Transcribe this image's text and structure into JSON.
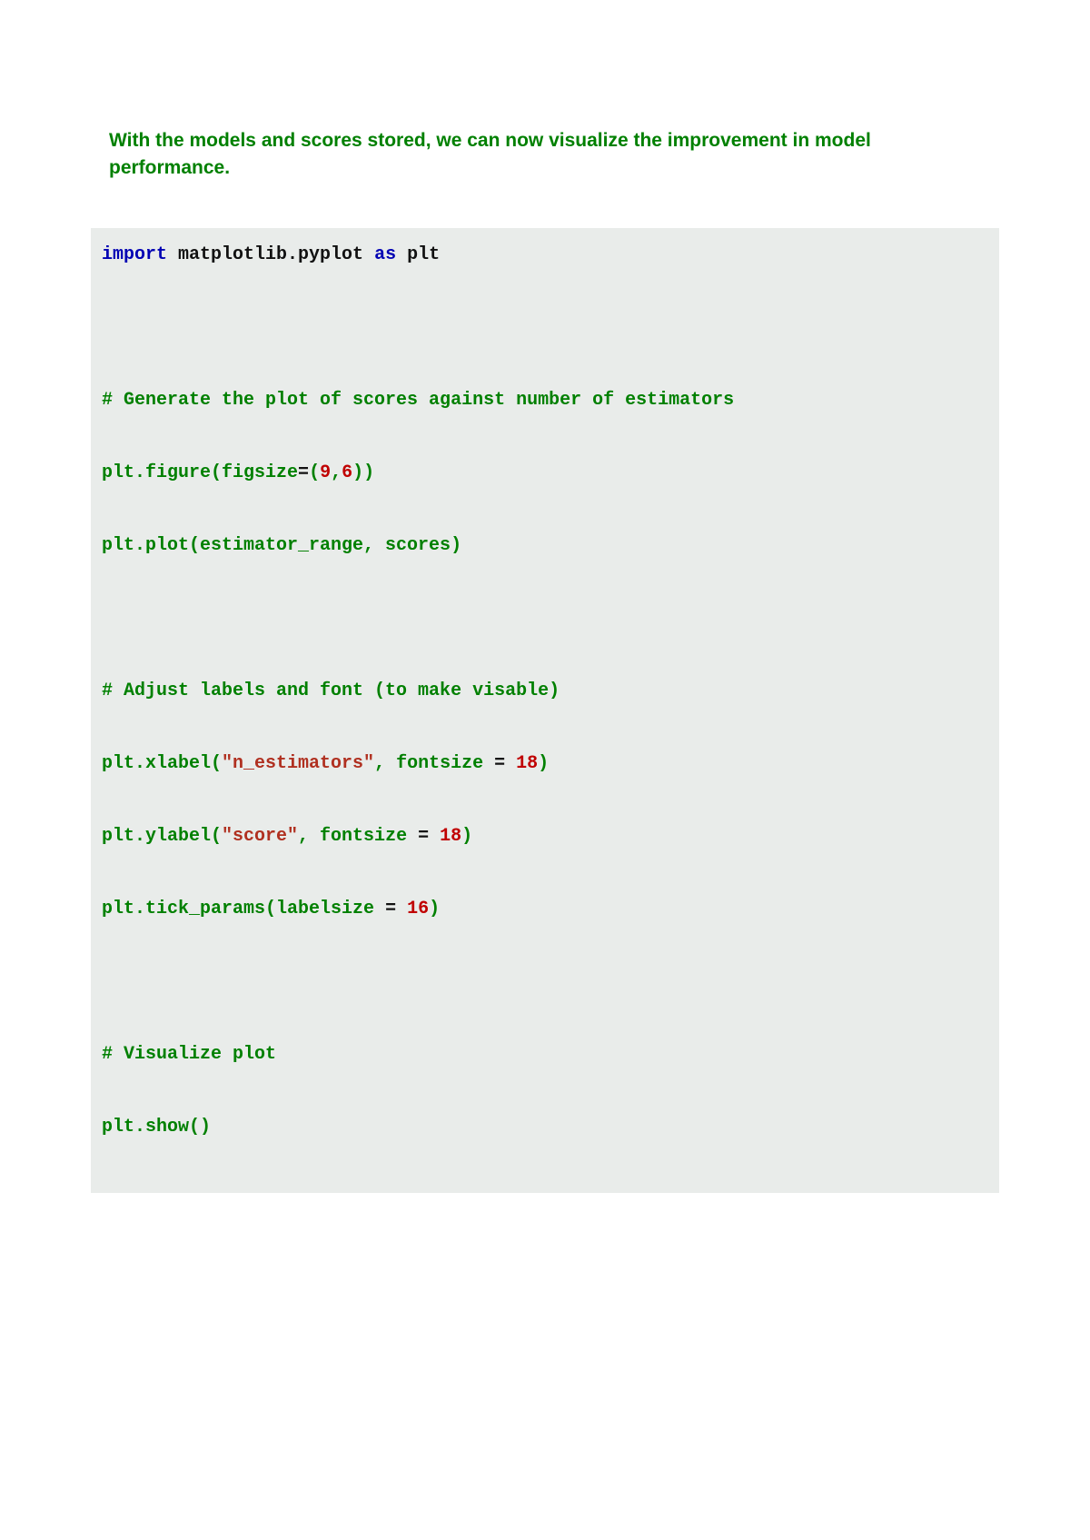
{
  "intro": "With the models and scores stored, we can now visualize the improvement in model performance.",
  "code": {
    "l1_kw1": "import",
    "l1_mod": " matplotlib.pyplot ",
    "l1_kw2": "as",
    "l1_alias": " plt",
    "l2_cmt": "# Generate the plot of scores against number of estimators",
    "l3_a": "plt.figure(figsize",
    "l3_b": "=",
    "l3_c": "(",
    "l3_n1": "9",
    "l3_d": ",",
    "l3_n2": "6",
    "l3_e": "))",
    "l4": "plt.plot(estimator_range, scores)",
    "l5_cmt": "# Adjust labels and font (to make visable)",
    "l6_a": "plt.xlabel(",
    "l6_s": "\"n_estimators\"",
    "l6_b": ", fontsize ",
    "l6_c": "=",
    "l6_d": " ",
    "l6_n": "18",
    "l6_e": ")",
    "l7_a": "plt.ylabel(",
    "l7_s": "\"score\"",
    "l7_b": ", fontsize ",
    "l7_c": "=",
    "l7_d": " ",
    "l7_n": "18",
    "l7_e": ")",
    "l8_a": "plt.tick_params(labelsize ",
    "l8_b": "=",
    "l8_c": " ",
    "l8_n": "16",
    "l8_d": ")",
    "l9_cmt": "# Visualize plot",
    "l10": "plt.show()"
  }
}
